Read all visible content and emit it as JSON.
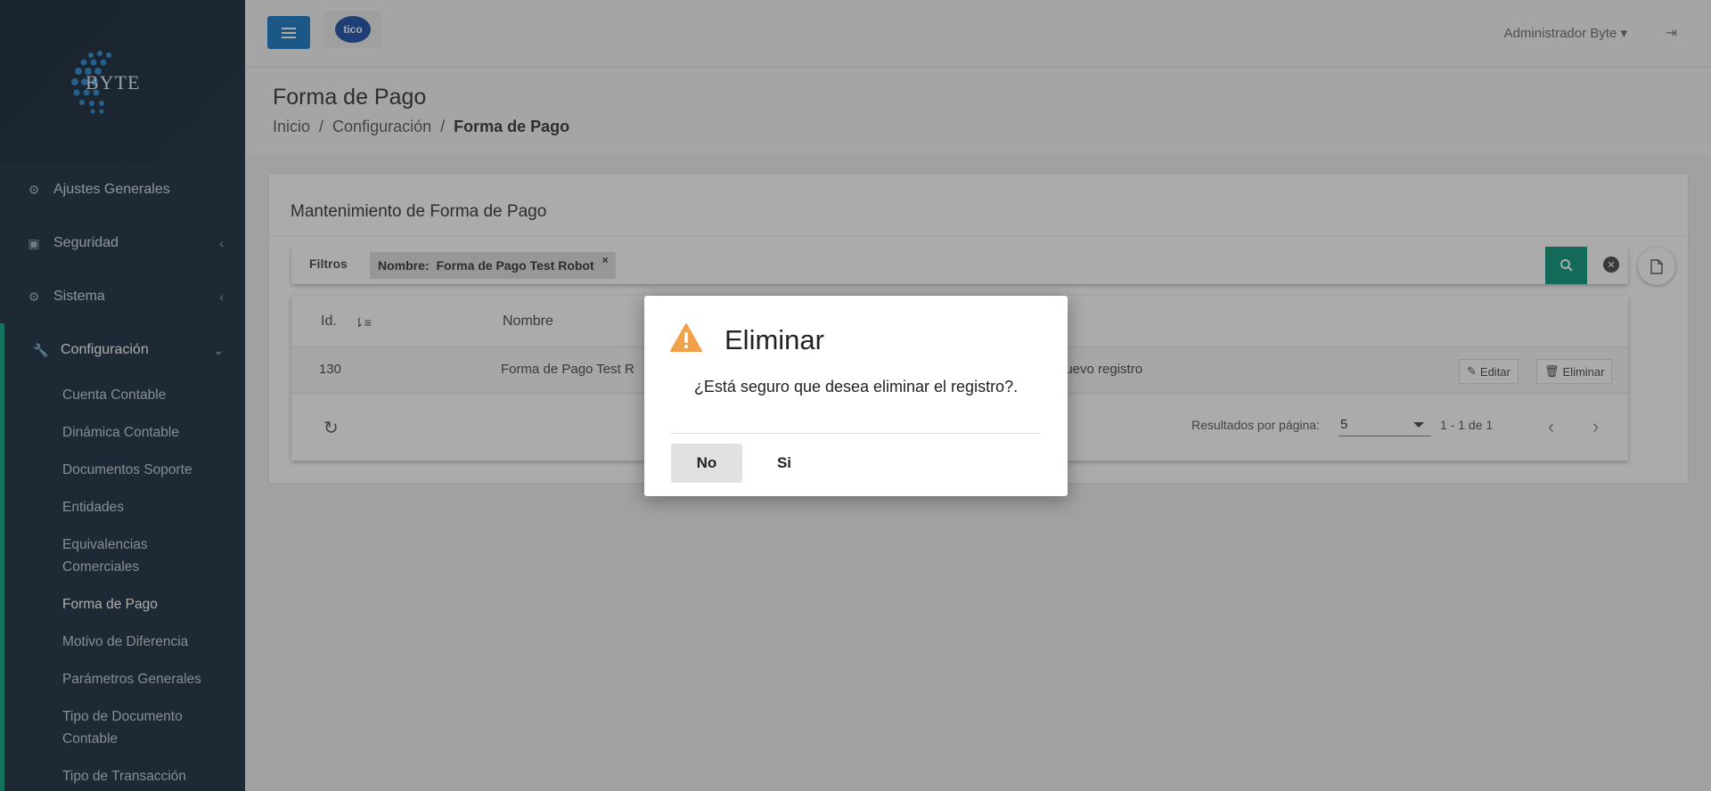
{
  "brand": {
    "logo_text": "BYTE"
  },
  "header": {
    "user": "Administrador Byte ▾",
    "tico_label": "tico"
  },
  "sidebar": {
    "items": [
      {
        "label": "Ajustes Generales"
      },
      {
        "label": "Seguridad"
      },
      {
        "label": "Sistema"
      },
      {
        "label": "Configuración"
      }
    ],
    "config_children": [
      "Cuenta Contable",
      "Dinámica Contable",
      "Documentos Soporte",
      "Entidades",
      "Equivalencias Comerciales",
      "Forma de Pago",
      "Motivo de Diferencia",
      "Parámetros Generales",
      "Tipo de Documento Contable",
      "Tipo de Transacción"
    ]
  },
  "page": {
    "title": "Forma de Pago",
    "breadcrumb": [
      "Inicio",
      "/",
      "Configuración",
      "/",
      "Forma de Pago"
    ]
  },
  "card": {
    "title": "Mantenimiento de Forma de Pago",
    "filters_label": "Filtros",
    "chip_key": "Nombre:",
    "chip_value": "Forma de Pago Test Robot",
    "chip_remove": "×"
  },
  "table": {
    "headers": [
      "Id.",
      "Nombre"
    ],
    "rows": [
      {
        "id": "130",
        "nombre": "Forma de Pago Test R",
        "desc": "nuevo registro"
      }
    ],
    "edit_label": "Editar",
    "delete_label": "Eliminar",
    "rpp_label": "Resultados por página:",
    "rpp_value": "5",
    "range": "1 - 1 de 1"
  },
  "modal": {
    "title": "Eliminar",
    "message": "¿Está seguro que desea eliminar el registro?.",
    "no_label": "No",
    "yes_label": "Si"
  },
  "colors": {
    "accent": "#1aaf8b",
    "primary": "#2a84c9",
    "search": "#1e9e84",
    "warning": "#f0a24a"
  }
}
